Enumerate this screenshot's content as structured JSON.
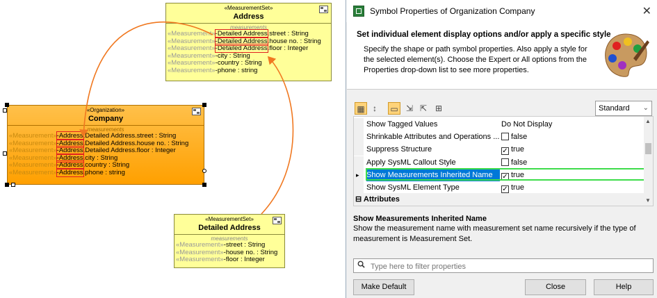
{
  "canvas": {
    "address": {
      "stereotype": "«MeasurementSet»",
      "name": "Address",
      "compartment": "measurements",
      "rows": [
        {
          "st": "«Measurement»",
          "hl": "-Detailed Address",
          "rest": ".street : String"
        },
        {
          "st": "«Measurement»",
          "hl": "-Detailed Address",
          "rest": ".house no. : String"
        },
        {
          "st": "«Measurement»",
          "hl": "-Detailed Address",
          "rest": ".floor : Integer"
        },
        {
          "st": "«Measurement»",
          "hl": "",
          "rest": "-city : String"
        },
        {
          "st": "«Measurement»",
          "hl": "",
          "rest": "-country : String"
        },
        {
          "st": "«Measurement»",
          "hl": "",
          "rest": "-phone : string"
        }
      ]
    },
    "company": {
      "stereotype": "«Organization»",
      "name": "Company",
      "compartment": "measurements",
      "rows": [
        {
          "st": "«Measurement»",
          "hl": "-Address",
          "rest": ".Detailed Address.street : String"
        },
        {
          "st": "«Measurement»",
          "hl": "-Address",
          "rest": ".Detailed Address.house no. : String"
        },
        {
          "st": "«Measurement»",
          "hl": "-Address",
          "rest": ".Detailed Address.floor : Integer"
        },
        {
          "st": "«Measurement»",
          "hl": "-Address",
          "rest": ".city : String"
        },
        {
          "st": "«Measurement»",
          "hl": "-Address",
          "rest": ".country : String"
        },
        {
          "st": "«Measurement»",
          "hl": "-Address",
          "rest": ".phone : string"
        }
      ]
    },
    "detailed": {
      "stereotype": "«MeasurementSet»",
      "name": "Detailed Address",
      "compartment": "measurements",
      "rows": [
        {
          "st": "«Measurement»",
          "hl": "",
          "rest": "-street : String"
        },
        {
          "st": "«Measurement»",
          "hl": "",
          "rest": "-house no. : String"
        },
        {
          "st": "«Measurement»",
          "hl": "",
          "rest": "-floor : Integer"
        }
      ]
    },
    "link_color": "#f07820"
  },
  "dialog": {
    "title": "Symbol Properties of Organization Company",
    "close_glyph": "✕",
    "heading": "Set individual element display options and/or apply a specific style",
    "description": "Specify the shape or path symbol properties. Also apply a style for the selected element(s). Choose the Expert or All options from the Properties drop-down list to see more properties.",
    "mode_select": "Standard",
    "rows": [
      {
        "name": "Show Tagged Values",
        "value": "Do Not Display",
        "check": false,
        "checked": false
      },
      {
        "name": "Shrinkable Attributes and Operations ...",
        "value": "false",
        "check": true,
        "checked": false
      },
      {
        "name": "Suppress Structure",
        "value": "true",
        "check": true,
        "checked": true
      },
      {
        "name": "Apply SysML Callout Style",
        "value": "false",
        "check": true,
        "checked": false
      },
      {
        "name": "Show Measurements Inherited Name",
        "value": "true",
        "check": true,
        "checked": true
      },
      {
        "name": "Show SysML Element Type",
        "value": "true",
        "check": true,
        "checked": true
      }
    ],
    "category": {
      "toggle": "⊟",
      "label": "Attributes"
    },
    "desc_title": "Show Measurements Inherited Name",
    "desc_text": "Show the measurement name with measurement set name recursively if the type of measurement is Measurement Set.",
    "filter_placeholder": "Type here to filter properties",
    "buttons": {
      "make_default": "Make Default",
      "close": "Close",
      "help": "Help"
    },
    "selection_color": "#0078d7",
    "highlight_color": "#3ddc4a"
  }
}
